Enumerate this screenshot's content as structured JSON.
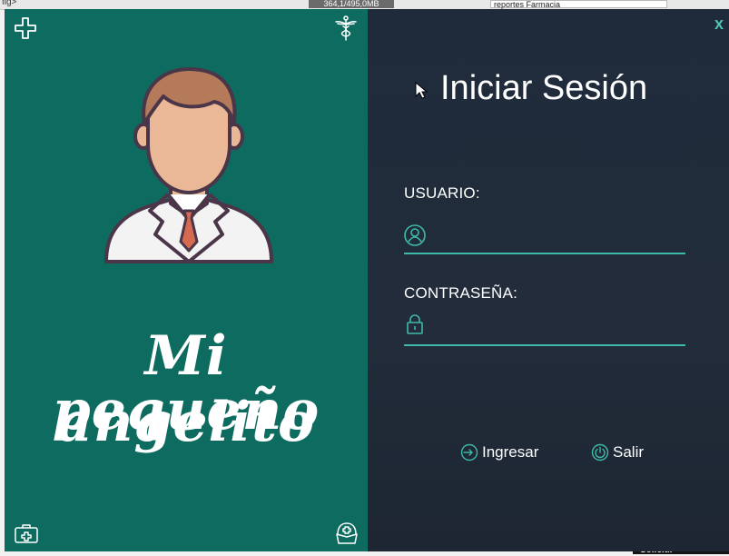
{
  "background": {
    "toolbar_fragment": "fig>",
    "memory_indicator": "364,1/495,0MB",
    "editor_tab": "reportes Farmacia",
    "status_fragment": "Solicit.l"
  },
  "login": {
    "close_label": "x",
    "title": "Iniciar Sesión",
    "brand": {
      "line1": "Mi pequeño",
      "line2": "angelito"
    },
    "username": {
      "label": "USUARIO:",
      "value": "",
      "placeholder": ""
    },
    "password": {
      "label": "CONTRASEÑA:",
      "value": "",
      "placeholder": ""
    },
    "buttons": {
      "login": "Ingresar",
      "exit": "Salir"
    }
  },
  "colors": {
    "left_panel": "#0d6b60",
    "right_panel": "#1f2b3b",
    "accent": "#3fb9a8"
  },
  "icons": {
    "top_left": "plus-cross-icon",
    "top_right": "caduceus-icon",
    "bottom_left": "medical-kit-icon",
    "bottom_right": "nurse-cap-icon",
    "user_field": "user-icon",
    "password_field": "lock-icon",
    "login_button": "sign-in-icon",
    "exit_button": "power-icon"
  }
}
